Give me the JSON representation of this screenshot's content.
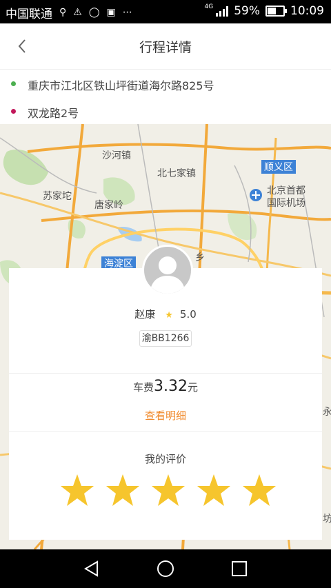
{
  "status_bar": {
    "carrier": "中国联通",
    "network": "4G",
    "battery_percent": "59%",
    "battery_level": 0.59,
    "time": "10:09"
  },
  "header": {
    "title": "行程详情"
  },
  "trip": {
    "origin": "重庆市江北区铁山坪街道海尔路825号",
    "destination": "双龙路2号",
    "origin_color": "#4caf50",
    "destination_color": "#c2185b"
  },
  "map": {
    "labels": {
      "shahezhen": "沙河镇",
      "beiqijia": "北七家镇",
      "shunyi": "顺义区",
      "airport_line1": "北京首都",
      "airport_line2": "国际机场",
      "sujiatuo": "苏家坨",
      "tangjialing": "唐家岭",
      "haidian": "海淀区",
      "xiang": "乡",
      "yong": "永",
      "fang": "坊"
    }
  },
  "driver": {
    "name": "赵康",
    "rating": "5.0",
    "plate": "渝BB1266"
  },
  "fare": {
    "prefix": "车费",
    "amount": "3.32",
    "unit": "元",
    "detail_link": "查看明细"
  },
  "rating": {
    "title": "我的评价",
    "stars": 5
  },
  "colors": {
    "accent": "#f08a2c",
    "star": "#f6c52d"
  }
}
